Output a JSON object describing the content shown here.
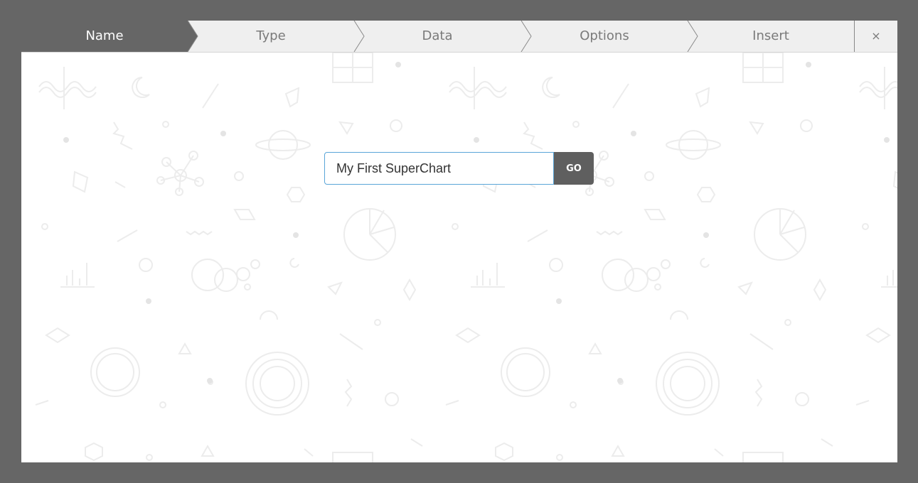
{
  "wizard": {
    "steps": [
      {
        "label": "Name",
        "active": true
      },
      {
        "label": "Type",
        "active": false
      },
      {
        "label": "Data",
        "active": false
      },
      {
        "label": "Options",
        "active": false
      },
      {
        "label": "Insert",
        "active": false
      }
    ],
    "close_label": "×"
  },
  "name_form": {
    "input_value": "My First SuperChart",
    "go_label": "GO"
  },
  "colors": {
    "backdrop": "#666666",
    "active_step": "#666666",
    "inactive_step": "#efefef",
    "input_border": "#5aa5d8",
    "go_button": "#5f5f5f"
  }
}
